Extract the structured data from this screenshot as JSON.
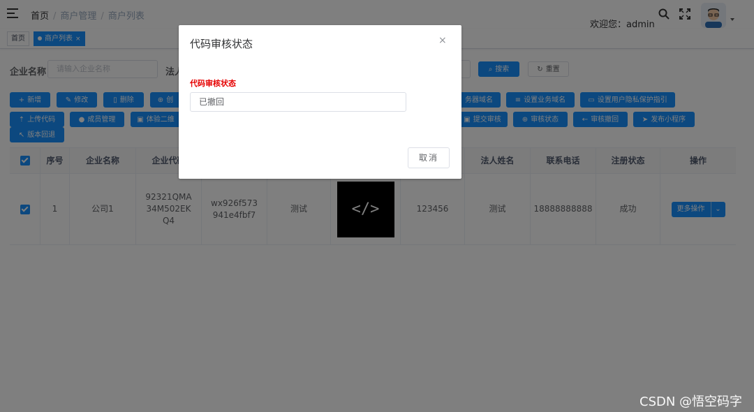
{
  "navbar": {
    "breadcrumb": [
      "首页",
      "商户管理",
      "商户列表"
    ],
    "welcome": "欢迎您：admin",
    "icons": [
      "hamburger-icon",
      "search-icon",
      "fullscreen-icon",
      "avatar",
      "caret-down-icon"
    ]
  },
  "tags": [
    {
      "label": "首页",
      "active": false
    },
    {
      "label": "商户列表",
      "active": true,
      "close": "×"
    }
  ],
  "search": {
    "company_label": "企业名称",
    "company_placeholder": "请输入企业名称",
    "legal_label": "法人",
    "search_btn": "搜索",
    "reset_btn": "重置"
  },
  "toolbar": {
    "row1": [
      "新增",
      "修改",
      "删除",
      "创",
      "务器域名",
      "设置业务域名",
      "设置用户隐私保护指引"
    ],
    "row2": [
      "上传代码",
      "成员管理",
      "体验二维",
      "提交审核",
      "审核状态",
      "审核撤回",
      "发布小程序"
    ],
    "row3": [
      "版本回退"
    ]
  },
  "table": {
    "headers": [
      "",
      "序号",
      "企业名称",
      "企业代码",
      "",
      "",
      "",
      "法人姓名",
      "联系电话",
      "注册状态",
      "操作"
    ],
    "rows": [
      {
        "index": "1",
        "company": "公司1",
        "code": "92321QMA34M502EKQ4",
        "appid": "wx926f573941e4fbf7",
        "test": "测试",
        "image": "</>",
        "num": "123456",
        "legal": "测试",
        "phone": "18888888888",
        "status": "成功",
        "action": "更多操作"
      }
    ]
  },
  "dialog": {
    "title": "代码审核状态",
    "close": "×",
    "label": "代码审核状态",
    "value": "已撤回",
    "cancel": "取消"
  },
  "watermark": "CSDN @悟空码字",
  "colors": {
    "primary": "#1890ff",
    "label_red": "#e60000",
    "overlay": "rgba(0,0,0,0.5)"
  }
}
